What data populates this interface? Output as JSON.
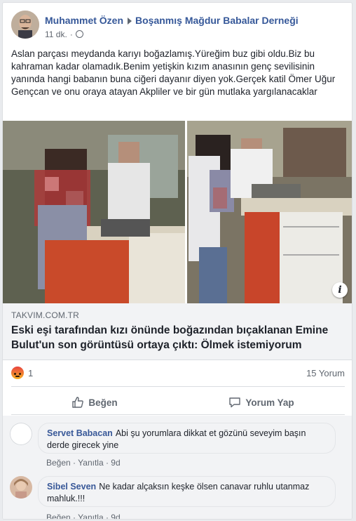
{
  "post": {
    "author": "Muhammet Özen",
    "target_group": "Boşanmış Mağdur Babalar Derneği",
    "time": "11 dk.",
    "audience_icon": "globe-icon",
    "text": "Aslan parçası meydanda karıyı boğazlamış.Yüreğim buz gibi oldu.Biz bu kahraman kadar olamadık.Benim yetişkin kızım anasının genç sevilisinin yanında hangi babanın buna ciğeri dayanır diyen yok.Gerçek katil Ömer Uğur Gençcan ve onu oraya atayan Akpliler ve bir gün mutlaka yargılanacaklar"
  },
  "link": {
    "domain": "TAKVIM.COM.TR",
    "title": "Eski eşi tarafından kızı önünde boğazından bıçaklanan Emine Bulut'un son görüntüsü ortaya çıktı: Ölmek istemiyorum",
    "info_icon": "info-icon"
  },
  "stats": {
    "reaction_icon": "angry-reaction-icon",
    "reaction_count": "1",
    "comment_count": "15 Yorum"
  },
  "actions": {
    "like_label": "Beğen",
    "comment_label": "Yorum Yap"
  },
  "comments": [
    {
      "author": "Servet Babacan",
      "text": "Abi şu yorumlara dikkat et gözünü seveyim başın derde girecek yine",
      "like": "Beğen",
      "reply": "Yanıtla",
      "time": "9d"
    },
    {
      "author": "Sibel Seven",
      "text": "Ne kadar alçaksın keşke ölsen canavar ruhlu utanmaz mahluk.!!!",
      "like": "Beğen",
      "reply": "Yanıtla",
      "time": "9d"
    }
  ],
  "colors": {
    "link_blue": "#365899",
    "text": "#1d2129",
    "muted": "#606770",
    "background": "#e9ebee"
  }
}
